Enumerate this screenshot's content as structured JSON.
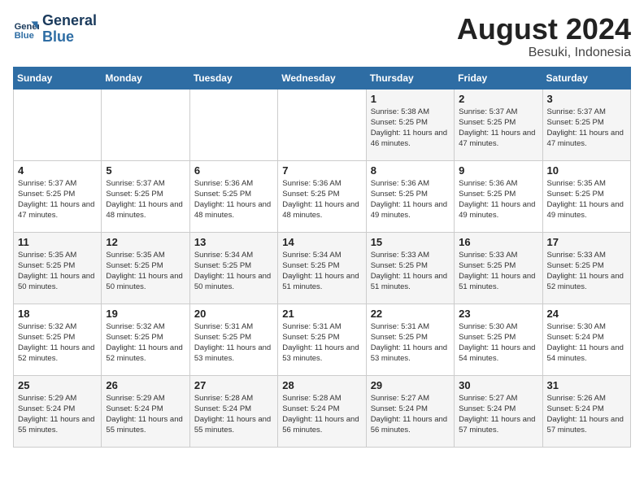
{
  "header": {
    "logo_line1": "General",
    "logo_line2": "Blue",
    "month_title": "August 2024",
    "location": "Besuki, Indonesia"
  },
  "days_of_week": [
    "Sunday",
    "Monday",
    "Tuesday",
    "Wednesday",
    "Thursday",
    "Friday",
    "Saturday"
  ],
  "weeks": [
    [
      {
        "day": "",
        "sunrise": "",
        "sunset": "",
        "daylight": ""
      },
      {
        "day": "",
        "sunrise": "",
        "sunset": "",
        "daylight": ""
      },
      {
        "day": "",
        "sunrise": "",
        "sunset": "",
        "daylight": ""
      },
      {
        "day": "",
        "sunrise": "",
        "sunset": "",
        "daylight": ""
      },
      {
        "day": "1",
        "sunrise": "Sunrise: 5:38 AM",
        "sunset": "Sunset: 5:25 PM",
        "daylight": "Daylight: 11 hours and 46 minutes."
      },
      {
        "day": "2",
        "sunrise": "Sunrise: 5:37 AM",
        "sunset": "Sunset: 5:25 PM",
        "daylight": "Daylight: 11 hours and 47 minutes."
      },
      {
        "day": "3",
        "sunrise": "Sunrise: 5:37 AM",
        "sunset": "Sunset: 5:25 PM",
        "daylight": "Daylight: 11 hours and 47 minutes."
      }
    ],
    [
      {
        "day": "4",
        "sunrise": "Sunrise: 5:37 AM",
        "sunset": "Sunset: 5:25 PM",
        "daylight": "Daylight: 11 hours and 47 minutes."
      },
      {
        "day": "5",
        "sunrise": "Sunrise: 5:37 AM",
        "sunset": "Sunset: 5:25 PM",
        "daylight": "Daylight: 11 hours and 48 minutes."
      },
      {
        "day": "6",
        "sunrise": "Sunrise: 5:36 AM",
        "sunset": "Sunset: 5:25 PM",
        "daylight": "Daylight: 11 hours and 48 minutes."
      },
      {
        "day": "7",
        "sunrise": "Sunrise: 5:36 AM",
        "sunset": "Sunset: 5:25 PM",
        "daylight": "Daylight: 11 hours and 48 minutes."
      },
      {
        "day": "8",
        "sunrise": "Sunrise: 5:36 AM",
        "sunset": "Sunset: 5:25 PM",
        "daylight": "Daylight: 11 hours and 49 minutes."
      },
      {
        "day": "9",
        "sunrise": "Sunrise: 5:36 AM",
        "sunset": "Sunset: 5:25 PM",
        "daylight": "Daylight: 11 hours and 49 minutes."
      },
      {
        "day": "10",
        "sunrise": "Sunrise: 5:35 AM",
        "sunset": "Sunset: 5:25 PM",
        "daylight": "Daylight: 11 hours and 49 minutes."
      }
    ],
    [
      {
        "day": "11",
        "sunrise": "Sunrise: 5:35 AM",
        "sunset": "Sunset: 5:25 PM",
        "daylight": "Daylight: 11 hours and 50 minutes."
      },
      {
        "day": "12",
        "sunrise": "Sunrise: 5:35 AM",
        "sunset": "Sunset: 5:25 PM",
        "daylight": "Daylight: 11 hours and 50 minutes."
      },
      {
        "day": "13",
        "sunrise": "Sunrise: 5:34 AM",
        "sunset": "Sunset: 5:25 PM",
        "daylight": "Daylight: 11 hours and 50 minutes."
      },
      {
        "day": "14",
        "sunrise": "Sunrise: 5:34 AM",
        "sunset": "Sunset: 5:25 PM",
        "daylight": "Daylight: 11 hours and 51 minutes."
      },
      {
        "day": "15",
        "sunrise": "Sunrise: 5:33 AM",
        "sunset": "Sunset: 5:25 PM",
        "daylight": "Daylight: 11 hours and 51 minutes."
      },
      {
        "day": "16",
        "sunrise": "Sunrise: 5:33 AM",
        "sunset": "Sunset: 5:25 PM",
        "daylight": "Daylight: 11 hours and 51 minutes."
      },
      {
        "day": "17",
        "sunrise": "Sunrise: 5:33 AM",
        "sunset": "Sunset: 5:25 PM",
        "daylight": "Daylight: 11 hours and 52 minutes."
      }
    ],
    [
      {
        "day": "18",
        "sunrise": "Sunrise: 5:32 AM",
        "sunset": "Sunset: 5:25 PM",
        "daylight": "Daylight: 11 hours and 52 minutes."
      },
      {
        "day": "19",
        "sunrise": "Sunrise: 5:32 AM",
        "sunset": "Sunset: 5:25 PM",
        "daylight": "Daylight: 11 hours and 52 minutes."
      },
      {
        "day": "20",
        "sunrise": "Sunrise: 5:31 AM",
        "sunset": "Sunset: 5:25 PM",
        "daylight": "Daylight: 11 hours and 53 minutes."
      },
      {
        "day": "21",
        "sunrise": "Sunrise: 5:31 AM",
        "sunset": "Sunset: 5:25 PM",
        "daylight": "Daylight: 11 hours and 53 minutes."
      },
      {
        "day": "22",
        "sunrise": "Sunrise: 5:31 AM",
        "sunset": "Sunset: 5:25 PM",
        "daylight": "Daylight: 11 hours and 53 minutes."
      },
      {
        "day": "23",
        "sunrise": "Sunrise: 5:30 AM",
        "sunset": "Sunset: 5:25 PM",
        "daylight": "Daylight: 11 hours and 54 minutes."
      },
      {
        "day": "24",
        "sunrise": "Sunrise: 5:30 AM",
        "sunset": "Sunset: 5:24 PM",
        "daylight": "Daylight: 11 hours and 54 minutes."
      }
    ],
    [
      {
        "day": "25",
        "sunrise": "Sunrise: 5:29 AM",
        "sunset": "Sunset: 5:24 PM",
        "daylight": "Daylight: 11 hours and 55 minutes."
      },
      {
        "day": "26",
        "sunrise": "Sunrise: 5:29 AM",
        "sunset": "Sunset: 5:24 PM",
        "daylight": "Daylight: 11 hours and 55 minutes."
      },
      {
        "day": "27",
        "sunrise": "Sunrise: 5:28 AM",
        "sunset": "Sunset: 5:24 PM",
        "daylight": "Daylight: 11 hours and 55 minutes."
      },
      {
        "day": "28",
        "sunrise": "Sunrise: 5:28 AM",
        "sunset": "Sunset: 5:24 PM",
        "daylight": "Daylight: 11 hours and 56 minutes."
      },
      {
        "day": "29",
        "sunrise": "Sunrise: 5:27 AM",
        "sunset": "Sunset: 5:24 PM",
        "daylight": "Daylight: 11 hours and 56 minutes."
      },
      {
        "day": "30",
        "sunrise": "Sunrise: 5:27 AM",
        "sunset": "Sunset: 5:24 PM",
        "daylight": "Daylight: 11 hours and 57 minutes."
      },
      {
        "day": "31",
        "sunrise": "Sunrise: 5:26 AM",
        "sunset": "Sunset: 5:24 PM",
        "daylight": "Daylight: 11 hours and 57 minutes."
      }
    ]
  ]
}
